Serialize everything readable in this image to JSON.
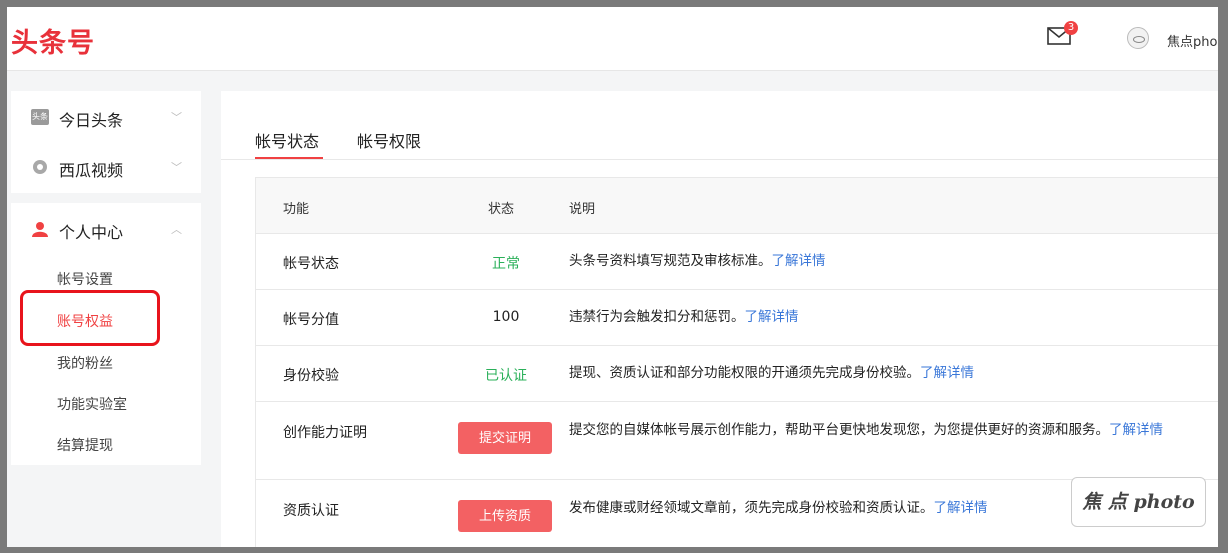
{
  "header": {
    "logo": "头条号",
    "mail_badge": "3",
    "user_name": "焦点pho"
  },
  "sidebar": {
    "platforms": [
      {
        "label": "今日头条",
        "icon": "toutiao-icon",
        "icon_text": "头条"
      },
      {
        "label": "西瓜视频",
        "icon": "xigua-icon"
      }
    ],
    "personal_center": {
      "label": "个人中心",
      "items": [
        {
          "label": "帐号设置"
        },
        {
          "label": "账号权益",
          "active": true
        },
        {
          "label": "我的粉丝"
        },
        {
          "label": "功能实验室"
        },
        {
          "label": "结算提现"
        }
      ]
    }
  },
  "main": {
    "tabs": [
      {
        "label": "帐号状态",
        "active": true
      },
      {
        "label": "帐号权限"
      }
    ],
    "table": {
      "headers": {
        "func": "功能",
        "status": "状态",
        "desc": "说明"
      },
      "rows": [
        {
          "func": "帐号状态",
          "status": "正常",
          "desc": "头条号资料填写规范及审核标准。",
          "link": "了解详情"
        },
        {
          "func": "帐号分值",
          "status": "100",
          "desc": "违禁行为会触发扣分和惩罚。",
          "link": "了解详情"
        },
        {
          "func": "身份校验",
          "status": "已认证",
          "desc": "提现、资质认证和部分功能权限的开通须先完成身份校验。",
          "link": "了解详情"
        },
        {
          "func": "创作能力证明",
          "button": "提交证明",
          "desc": "提交您的自媒体帐号展示创作能力，帮助平台更快地发现您，为您提供更好的资源和服务。",
          "link": "了解详情"
        },
        {
          "func": "资质认证",
          "button": "上传资质",
          "desc": "发布健康或财经领域文章前，须先完成身份校验和资质认证。",
          "link": "了解详情"
        }
      ]
    }
  },
  "watermark": "焦 点 photo",
  "colors": {
    "brand_red": "#e8313a",
    "status_green": "#2bb05a",
    "link_blue": "#3a77d8",
    "button_red": "#f36163"
  }
}
